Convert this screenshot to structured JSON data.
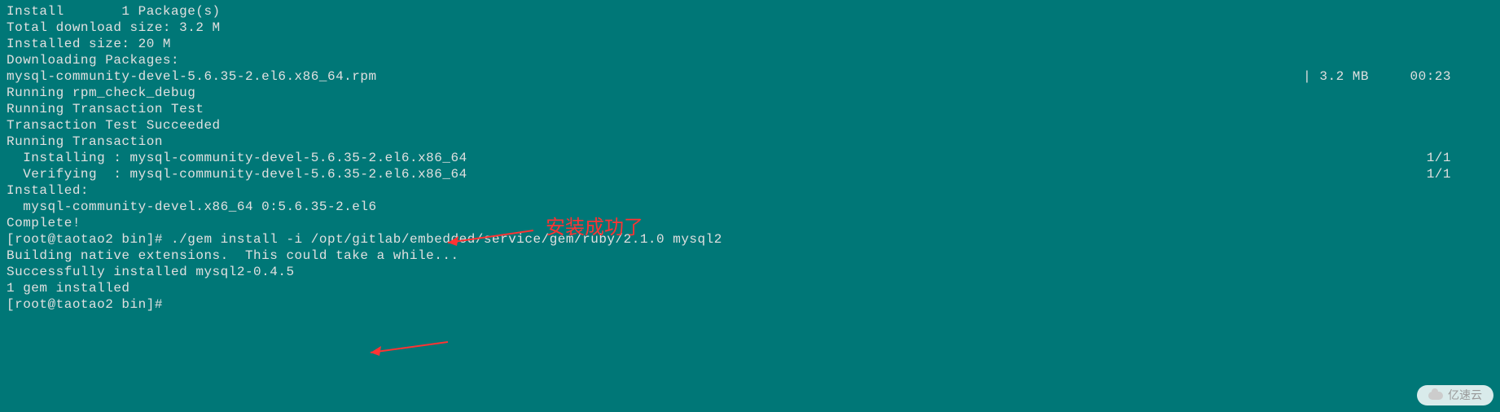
{
  "terminal": {
    "lines": [
      "Install       1 Package(s)",
      "",
      "Total download size: 3.2 M",
      "Installed size: 20 M",
      "Downloading Packages:"
    ],
    "download_line": {
      "left": "mysql-community-devel-5.6.35-2.el6.x86_64.rpm",
      "right": "| 3.2 MB     00:23"
    },
    "lines2": [
      "Running rpm_check_debug",
      "Running Transaction Test",
      "Transaction Test Succeeded",
      "Running Transaction"
    ],
    "install_line": {
      "left": "  Installing : mysql-community-devel-5.6.35-2.el6.x86_64",
      "right": "1/1"
    },
    "verify_line": {
      "left": "  Verifying  : mysql-community-devel-5.6.35-2.el6.x86_64",
      "right": "1/1"
    },
    "lines3": [
      "",
      "Installed:",
      "  mysql-community-devel.x86_64 0:5.6.35-2.el6",
      "",
      "Complete!",
      "[root@taotao2 bin]# ./gem install -i /opt/gitlab/embedded/service/gem/ruby/2.1.0 mysql2",
      "Building native extensions.  This could take a while...",
      "Successfully installed mysql2-0.4.5",
      "1 gem installed",
      "[root@taotao2 bin]#"
    ]
  },
  "annotation": {
    "text": "安装成功了"
  },
  "watermark": {
    "text": "亿速云"
  }
}
